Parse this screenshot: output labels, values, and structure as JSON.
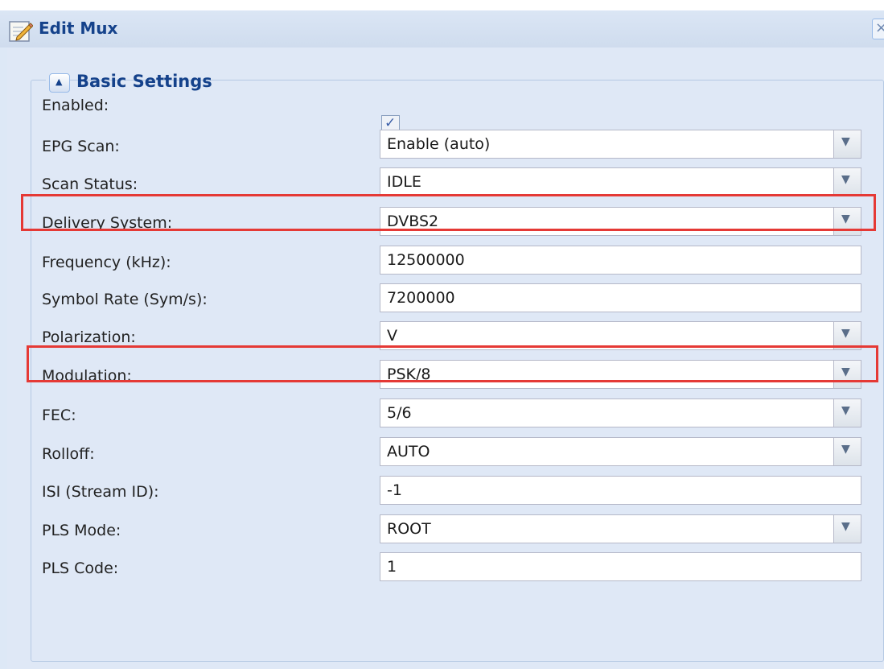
{
  "window": {
    "title": "Edit Mux",
    "close_glyph": "×",
    "icon": "edit-pencil-icon"
  },
  "fieldset": {
    "title": "Basic Settings",
    "collapse_glyph": "▲"
  },
  "fields": {
    "enabled": {
      "label": "Enabled:",
      "checked": true,
      "check_glyph": "✓"
    },
    "epg_scan": {
      "label": "EPG Scan:",
      "value": "Enable (auto)"
    },
    "scan_status": {
      "label": "Scan Status:",
      "value": "IDLE"
    },
    "delivery_system": {
      "label": "Delivery System:",
      "value": "DVBS2"
    },
    "frequency": {
      "label": "Frequency (kHz):",
      "value": "12500000"
    },
    "symbol_rate": {
      "label": "Symbol Rate (Sym/s):",
      "value": "7200000"
    },
    "polarization": {
      "label": "Polarization:",
      "value": "V"
    },
    "modulation": {
      "label": "Modulation:",
      "value": "PSK/8"
    },
    "fec": {
      "label": "FEC:",
      "value": "5/6"
    },
    "rolloff": {
      "label": "Rolloff:",
      "value": "AUTO"
    },
    "isi": {
      "label": "ISI (Stream ID):",
      "value": "-1"
    },
    "pls_mode": {
      "label": "PLS Mode:",
      "value": "ROOT"
    },
    "pls_code": {
      "label": "PLS Code:",
      "value": "1"
    }
  },
  "dropdown_glyph": "▼",
  "colors": {
    "title_text": "#15428b",
    "highlight": "#e53935",
    "panel_bg": "#dfe8f6"
  }
}
